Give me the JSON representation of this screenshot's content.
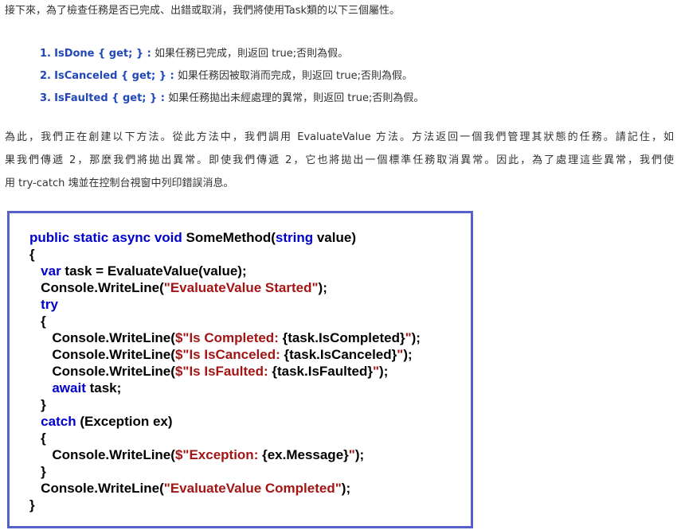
{
  "intro": "接下來，為了檢查任務是否已完成、出錯或取消，我們將使用Task類的以下三個屬性。",
  "properties": [
    {
      "number": "1.",
      "name": "IsDone { get; } :",
      "desc": " 如果任務已完成，則返回 true;否則為假。"
    },
    {
      "number": "2.",
      "name": "IsCanceled { get; } :",
      "desc": " 如果任務因被取消而完成，則返回 true;否則為假。"
    },
    {
      "number": "3.",
      "name": "IsFaulted { get; } :",
      "desc": " 如果任務拋出未經處理的異常，則返回 true;否則為假。"
    }
  ],
  "paragraph": [
    "為此，我們正在創建以下方法。從此方法中，我們調用 EvaluateValue 方法。方法返回一個我們管理其狀態的任務。請記住，如",
    "果我們傳遞 2，那麼我們將拋出異常。即使我們傳遞 2，它也將拋出一個標準任務取消異常。因此，為了處理這些異常，我們使",
    "用 try-catch 塊並在控制台視窗中列印錯誤消息。"
  ],
  "code": [
    [
      {
        "t": "public static async void",
        "c": "kw"
      },
      {
        "t": " SomeMethod(",
        "c": ""
      },
      {
        "t": "string",
        "c": "kw"
      },
      {
        "t": " value)",
        "c": ""
      }
    ],
    [
      {
        "t": "{",
        "c": ""
      }
    ],
    [
      {
        "t": "   ",
        "c": ""
      },
      {
        "t": "var",
        "c": "kw"
      },
      {
        "t": " task = EvaluateValue(value);",
        "c": ""
      }
    ],
    [
      {
        "t": "   Console.WriteLine(",
        "c": ""
      },
      {
        "t": "\"EvaluateValue Started\"",
        "c": "str"
      },
      {
        "t": ");",
        "c": ""
      }
    ],
    [
      {
        "t": "   ",
        "c": ""
      },
      {
        "t": "try",
        "c": "kw"
      }
    ],
    [
      {
        "t": "   {",
        "c": ""
      }
    ],
    [
      {
        "t": "      Console.WriteLine(",
        "c": ""
      },
      {
        "t": "$\"Is Completed: ",
        "c": "str"
      },
      {
        "t": "{task.IsCompleted}",
        "c": ""
      },
      {
        "t": "\"",
        "c": "str"
      },
      {
        "t": ");",
        "c": ""
      }
    ],
    [
      {
        "t": "      Console.WriteLine(",
        "c": ""
      },
      {
        "t": "$\"Is IsCanceled: ",
        "c": "str"
      },
      {
        "t": "{task.IsCanceled}",
        "c": ""
      },
      {
        "t": "\"",
        "c": "str"
      },
      {
        "t": ");",
        "c": ""
      }
    ],
    [
      {
        "t": "      Console.WriteLine(",
        "c": ""
      },
      {
        "t": "$\"Is IsFaulted: ",
        "c": "str"
      },
      {
        "t": "{task.IsFaulted}",
        "c": ""
      },
      {
        "t": "\"",
        "c": "str"
      },
      {
        "t": ");",
        "c": ""
      }
    ],
    [
      {
        "t": "      ",
        "c": ""
      },
      {
        "t": "await",
        "c": "kw"
      },
      {
        "t": " task;",
        "c": ""
      }
    ],
    [
      {
        "t": "   }",
        "c": ""
      }
    ],
    [
      {
        "t": "   ",
        "c": ""
      },
      {
        "t": "catch",
        "c": "kw"
      },
      {
        "t": " (Exception ex)",
        "c": ""
      }
    ],
    [
      {
        "t": "   {",
        "c": ""
      }
    ],
    [
      {
        "t": "      Console.WriteLine(",
        "c": ""
      },
      {
        "t": "$\"Exception: ",
        "c": "str"
      },
      {
        "t": "{ex.Message}",
        "c": ""
      },
      {
        "t": "\"",
        "c": "str"
      },
      {
        "t": ");",
        "c": ""
      }
    ],
    [
      {
        "t": "   }",
        "c": ""
      }
    ],
    [
      {
        "t": "   Console.WriteLine(",
        "c": ""
      },
      {
        "t": "\"EvaluateValue Completed\"",
        "c": "str"
      },
      {
        "t": ");",
        "c": ""
      }
    ],
    [
      {
        "t": "}",
        "c": ""
      }
    ]
  ],
  "colors": {
    "accent": "#2147b8",
    "keyword": "#0000cc",
    "string": "#a31515",
    "border": "#5560c8"
  }
}
